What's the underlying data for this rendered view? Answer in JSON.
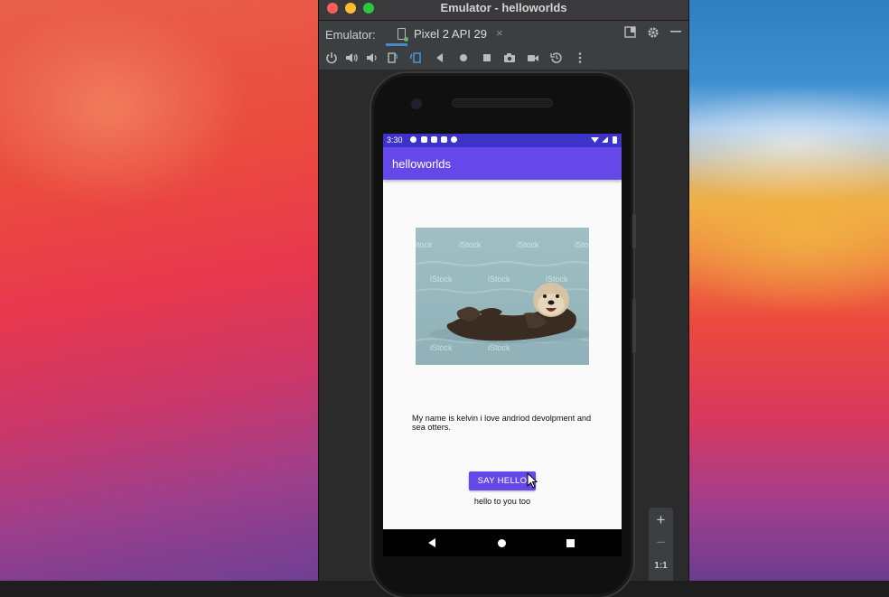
{
  "window": {
    "title": "Emulator - helloworlds"
  },
  "tabbar": {
    "emulator_label": "Emulator:",
    "device_tab_label": "Pixel 2 API 29",
    "close_glyph": "×"
  },
  "toolbar": {
    "icons": [
      "power-icon",
      "volume-up-icon",
      "volume-down-icon",
      "rotate-left-icon",
      "rotate-right-icon",
      "back-icon",
      "home-icon",
      "overview-icon",
      "screenshot-icon",
      "screen-record-icon",
      "snapshot-icon",
      "more-icon"
    ]
  },
  "device": {
    "status_time": "3:30",
    "app_title": "helloworlds",
    "bio_text": "My name is kelvin i love andriod devolpment and sea otters.",
    "button_label": "SAY HELLO",
    "reply_text": "hello to you too",
    "accent_color": "#6548ea",
    "status_bar_color": "#3d33c9"
  },
  "zoom": {
    "zoom_in": "+",
    "zoom_out": "−",
    "actual_size": "1:1"
  },
  "image": {
    "watermark": "iStock"
  }
}
